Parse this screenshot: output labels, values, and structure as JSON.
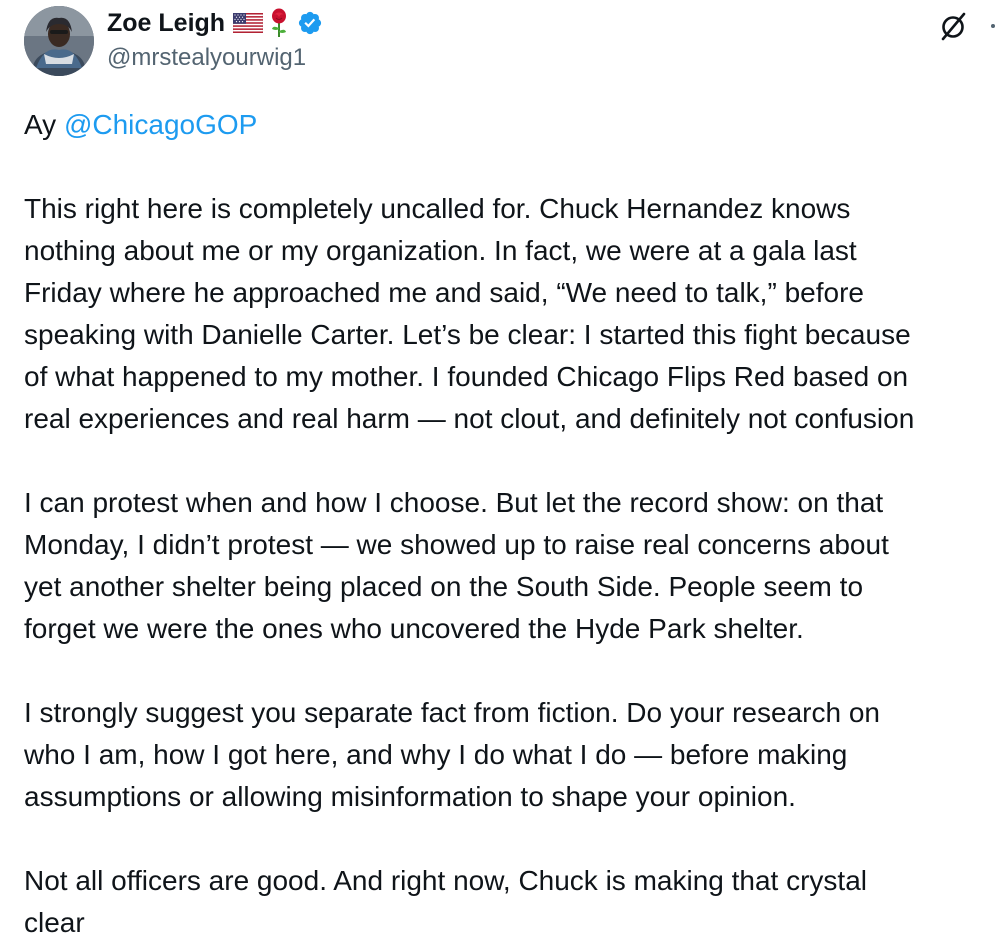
{
  "author": {
    "display_name": "Zoe Leigh",
    "handle": "@mrstealyourwig1",
    "badges": [
      "us-flag-icon",
      "rose-icon",
      "verified-badge-icon"
    ],
    "verified_color": "#1d9bf0"
  },
  "actions": {
    "grok_icon": "grok-icon",
    "more_icon": "more-options-icon"
  },
  "tweet": {
    "greeting": "Ay ",
    "mention": "@ChicagoGOP",
    "paragraph1": [
      "This right here is completely uncalled for. Chuck Hernandez knows",
      "nothing about me or my organization. In fact, we were at a gala last",
      "Friday where he approached me and said, “We need to talk,” before",
      "speaking with Danielle Carter. Let’s be clear: I started this fight because",
      "of what happened to my mother. I founded Chicago Flips Red based on",
      "real experiences and real harm — not clout, and definitely not confusion"
    ],
    "paragraph2": [
      "I can protest when and how I choose. But let the record show: on that",
      "Monday, I didn’t protest — we showed up to raise real concerns about",
      "yet another shelter being placed on the South Side. People seem to",
      "forget we were the ones who uncovered the Hyde Park shelter."
    ],
    "paragraph3": [
      "I strongly suggest you separate fact from fiction. Do your research on",
      "who I am, how I got here, and why I do what I do — before making",
      "assumptions or allowing misinformation to shape your opinion."
    ],
    "paragraph4": [
      "Not all officers are good. And right now, Chuck is making that crystal",
      "clear"
    ],
    "mention_color": "#1d9bf0",
    "text_color": "#0f1419",
    "secondary_color": "#536471"
  }
}
